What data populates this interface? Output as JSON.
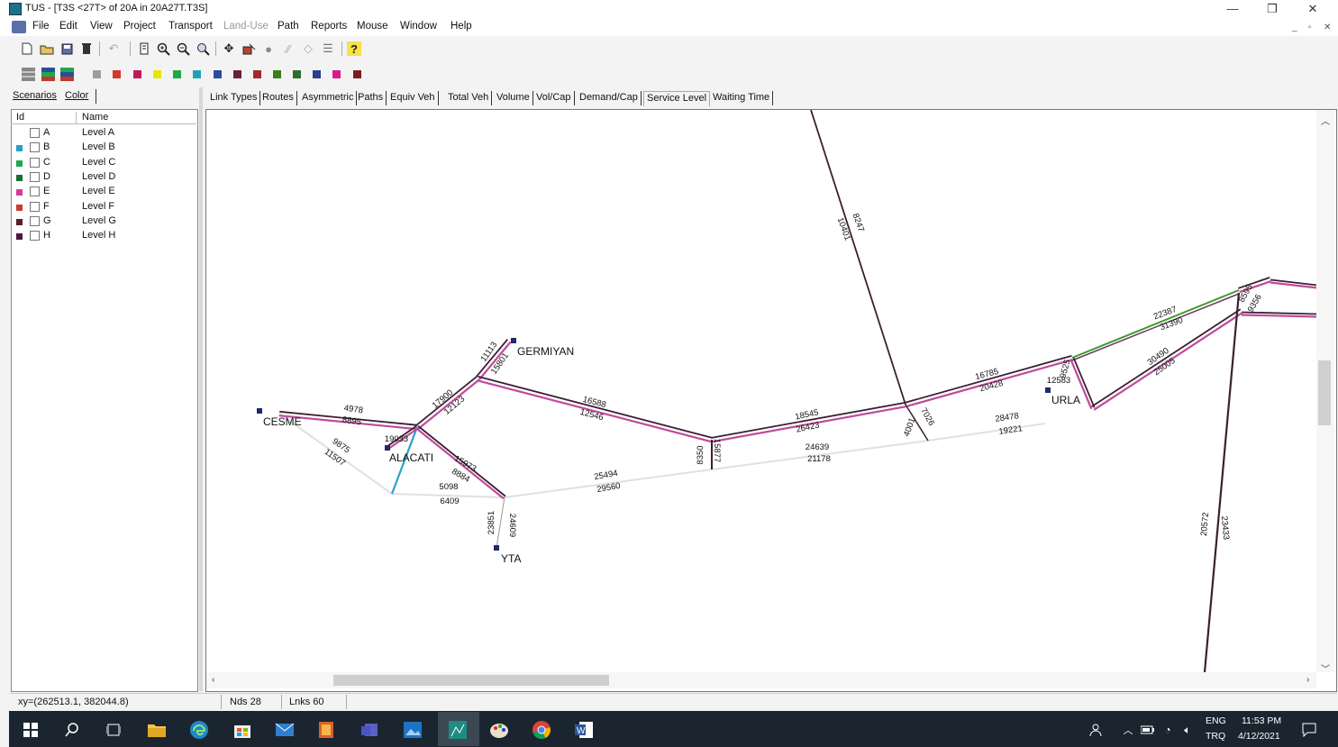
{
  "window": {
    "title": "TUS - [T3S <27T> of 20A in 20A27T.T3S]",
    "minimize": "—",
    "maximize": "❐",
    "close": "✕"
  },
  "menu": [
    "File",
    "Edit",
    "View",
    "Project",
    "Transport",
    "Land-Use",
    "Path",
    "Reports",
    "Mouse",
    "Window",
    "Help"
  ],
  "mdi_controls": {
    "min": "_",
    "restore": "▫",
    "close": "✕"
  },
  "toolbar": {
    "icons": [
      "new-file-icon",
      "open-folder-icon",
      "save-icon",
      "delete-icon",
      "undo-icon",
      "page-icon",
      "zoom-in-icon",
      "zoom-out-icon",
      "zoom-window-icon",
      "pan-icon",
      "select-node-icon",
      "node-icon",
      "link-icon",
      "move-node-icon",
      "align-icon",
      "help-icon"
    ],
    "help_glyph": "?"
  },
  "palette_colors": [
    "#9e9e9e",
    "#d0392f",
    "#c2185b",
    "#e6e600",
    "#1fa84b",
    "#21a0b8",
    "#2b4d9c",
    "#6b1f3f",
    "#a12a2a",
    "#3a7d1a",
    "#2a6f2a",
    "#2a3f8f",
    "#d81b8c",
    "#7a1f1f"
  ],
  "left_panel": {
    "tabs": [
      "Scenarios",
      "Color"
    ],
    "headers": {
      "id": "Id",
      "name": "Name"
    },
    "rows": [
      {
        "id": "A",
        "name": "Level A",
        "color": ""
      },
      {
        "id": "B",
        "name": "Level B",
        "color": "#21a0c8"
      },
      {
        "id": "C",
        "name": "Level C",
        "color": "#1fa84b"
      },
      {
        "id": "D",
        "name": "Level D",
        "color": "#1e6b33"
      },
      {
        "id": "E",
        "name": "Level E",
        "color": "#d23a9b"
      },
      {
        "id": "F",
        "name": "Level F",
        "color": "#d0392f"
      },
      {
        "id": "G",
        "name": "Level G",
        "color": "#5a1f2a"
      },
      {
        "id": "H",
        "name": "Level H",
        "color": "#4a1a3a"
      }
    ]
  },
  "map_tabs": [
    "Link Types",
    "Routes",
    "Asymmetric",
    "Paths",
    "Equiv Veh",
    "Total Veh",
    "Volume",
    "Vol/Cap",
    "Demand/Cap",
    "Service Level",
    "Waiting Time"
  ],
  "active_map_tab": "Service Level",
  "map": {
    "nodes": {
      "cesme": "CESME",
      "alacati": "ALACATI",
      "germiyan": "GERMIYAN",
      "yta": "YTA",
      "urla": "URLA"
    },
    "link_labels": [
      "4978",
      "8895",
      "9875",
      "11507",
      "19033",
      "17900",
      "12123",
      "15973",
      "8884",
      "5098",
      "6409",
      "11113",
      "15801",
      "16588",
      "12546",
      "25494",
      "29560",
      "23851",
      "24609",
      "8350",
      "15877",
      "18545",
      "26423",
      "24639",
      "21178",
      "8247",
      "10401",
      "7026",
      "4001",
      "16785",
      "20428",
      "28478",
      "19221",
      "12583",
      "9525",
      "22387",
      "31390",
      "30490",
      "25005",
      "20572",
      "23433",
      "8595",
      "9356"
    ]
  },
  "status": {
    "coords": "xy=(262513.1, 382044.8)",
    "nodes": "Nds 28",
    "links": "Lnks 60"
  },
  "taskbar": {
    "lang1": "ENG",
    "lang2": "TRQ",
    "time": "11:53 PM",
    "date": "4/12/2021"
  }
}
